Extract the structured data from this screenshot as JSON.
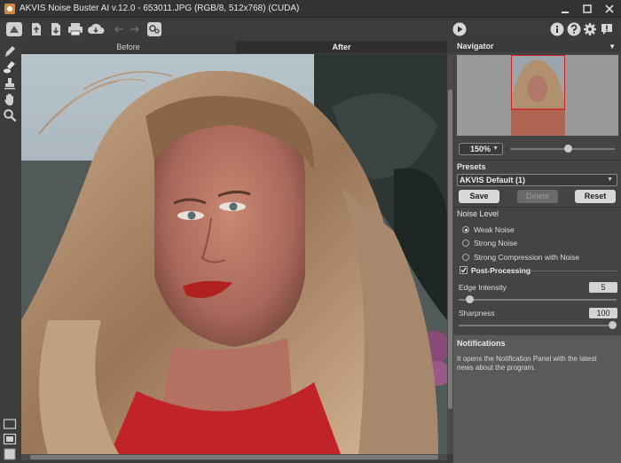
{
  "window": {
    "title": "AKVIS Noise Buster AI v.12.0 - 653011.JPG (RGB/8, 512x768) (CUDA)"
  },
  "toolbar": {
    "left_icons": [
      "home-icon",
      "open-file-icon",
      "save-file-icon",
      "print-icon",
      "download-icon",
      "undo-icon",
      "redo-icon",
      "settings-gear-icon"
    ],
    "right_icons": [
      "play-icon",
      "info-icon",
      "help-icon",
      "gear-icon",
      "notification-icon"
    ]
  },
  "tabs": {
    "before": "Before",
    "after": "After"
  },
  "navigator": {
    "title": "Navigator",
    "zoom": "150%"
  },
  "presets": {
    "title": "Presets",
    "selected": "AKVIS Default (1)",
    "save": "Save",
    "delete": "Delete",
    "reset": "Reset"
  },
  "noise_level": {
    "title": "Noise Level",
    "options": [
      "Weak Noise",
      "Strong Noise",
      "Strong Compression with Noise"
    ],
    "selected_index": 0
  },
  "post_processing": {
    "label": "Post-Processing",
    "checked": true,
    "edge_intensity_label": "Edge Intensity",
    "edge_intensity_value": "5",
    "edge_intensity_level": 0.05,
    "sharpness_label": "Sharpness",
    "sharpness_value": "100",
    "sharpness_level": 1.0
  },
  "notifications": {
    "title": "Notifications",
    "text": "It opens the Notification Panel with the latest news about the program."
  },
  "colors": {
    "background": "#3c3c3c",
    "panel": "#444444",
    "accent_selected_tab": "#2e2e2e"
  }
}
